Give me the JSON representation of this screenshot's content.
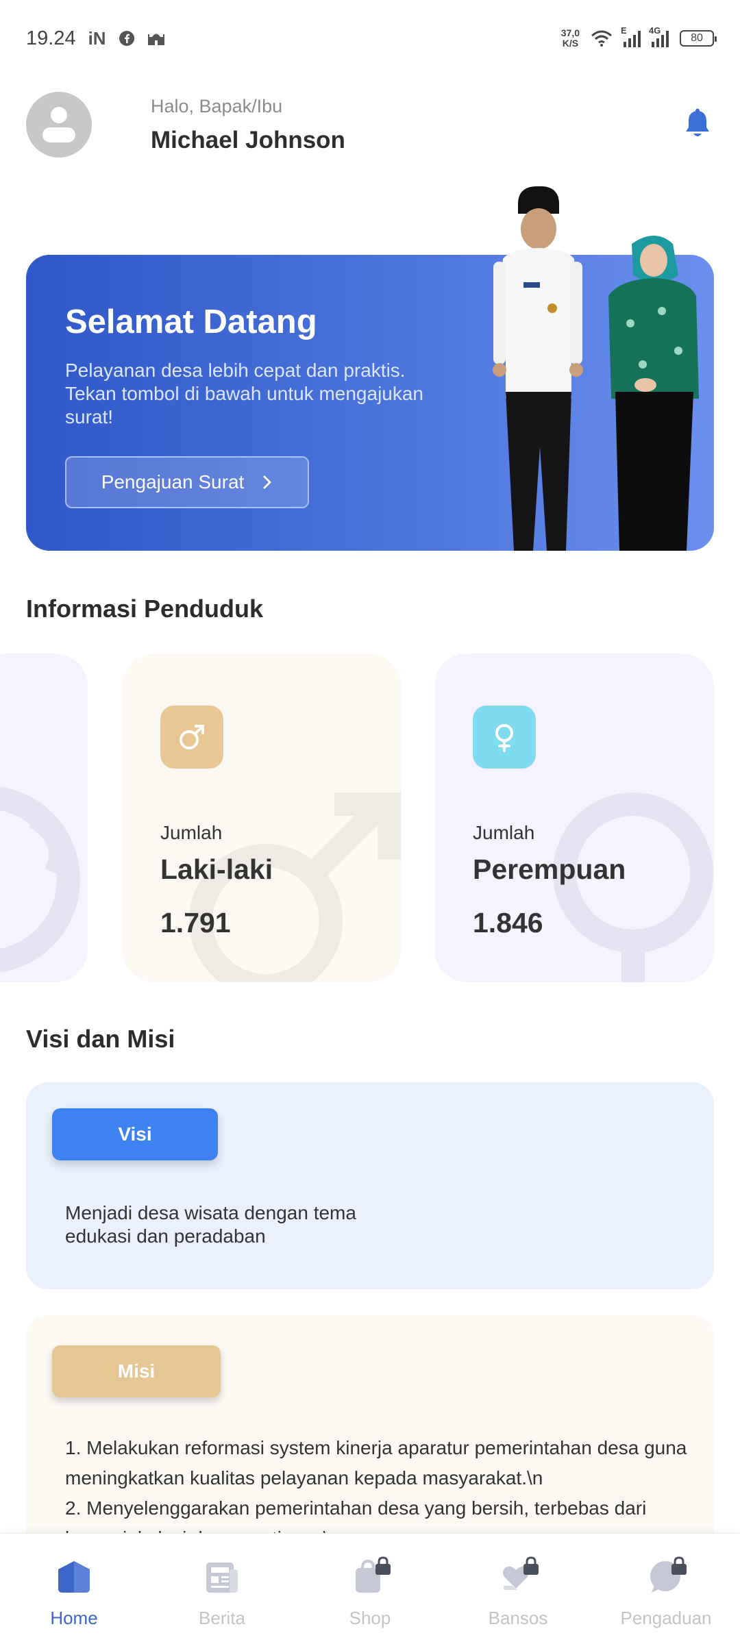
{
  "status_bar": {
    "time": "19.24",
    "notif_icons": [
      "iN",
      "facebook-icon",
      "mosque-icon"
    ],
    "net_speed_value": "37,0",
    "net_speed_unit": "K/S",
    "signal_1_tag": "E",
    "signal_2_tag": "4G",
    "battery": "80"
  },
  "header": {
    "greeting": "Halo, Bapak/Ibu",
    "name": "Michael Johnson"
  },
  "banner": {
    "title": "Selamat Datang",
    "description": "Pelayanan desa lebih cepat dan praktis. Tekan tombol di bawah untuk mengajukan surat!",
    "button_label": "Pengajuan Surat",
    "gradient_colors": [
      "#2f58c9",
      "#6b90ee"
    ]
  },
  "population": {
    "section_title": "Informasi Penduduk",
    "male": {
      "label_small": "Jumlah",
      "label_big": "Laki-laki",
      "count": "1.791",
      "chip_color": "#e8c795"
    },
    "female": {
      "label_small": "Jumlah",
      "label_big": "Perempuan",
      "count": "1.846",
      "chip_color": "#7fdbef"
    }
  },
  "visi_misi": {
    "section_title": "Visi dan Misi",
    "visi_label": "Visi",
    "visi_text": "Menjadi desa wisata dengan tema edukasi dan peradaban",
    "misi_label": "Misi",
    "misi_text": "1. Melakukan reformasi system kinerja aparatur pemerintahan desa guna meningkatkan kualitas pelayanan kepada masyarakat.\\n\n2. Menyelenggarakan pemerintahan desa yang bersih, terbebas dari korupsi, kolusi dan nepotisme.\\n"
  },
  "bottom_nav": {
    "items": [
      {
        "label": "Home",
        "icon": "home-icon",
        "active": true
      },
      {
        "label": "Berita",
        "icon": "news-icon",
        "active": false
      },
      {
        "label": "Shop",
        "icon": "shop-icon",
        "active": false
      },
      {
        "label": "Bansos",
        "icon": "bansos-icon",
        "active": false
      },
      {
        "label": "Pengaduan",
        "icon": "complaint-icon",
        "active": false
      }
    ],
    "active_color": "#3c67c8",
    "inactive_color": "#c3c3c3"
  }
}
